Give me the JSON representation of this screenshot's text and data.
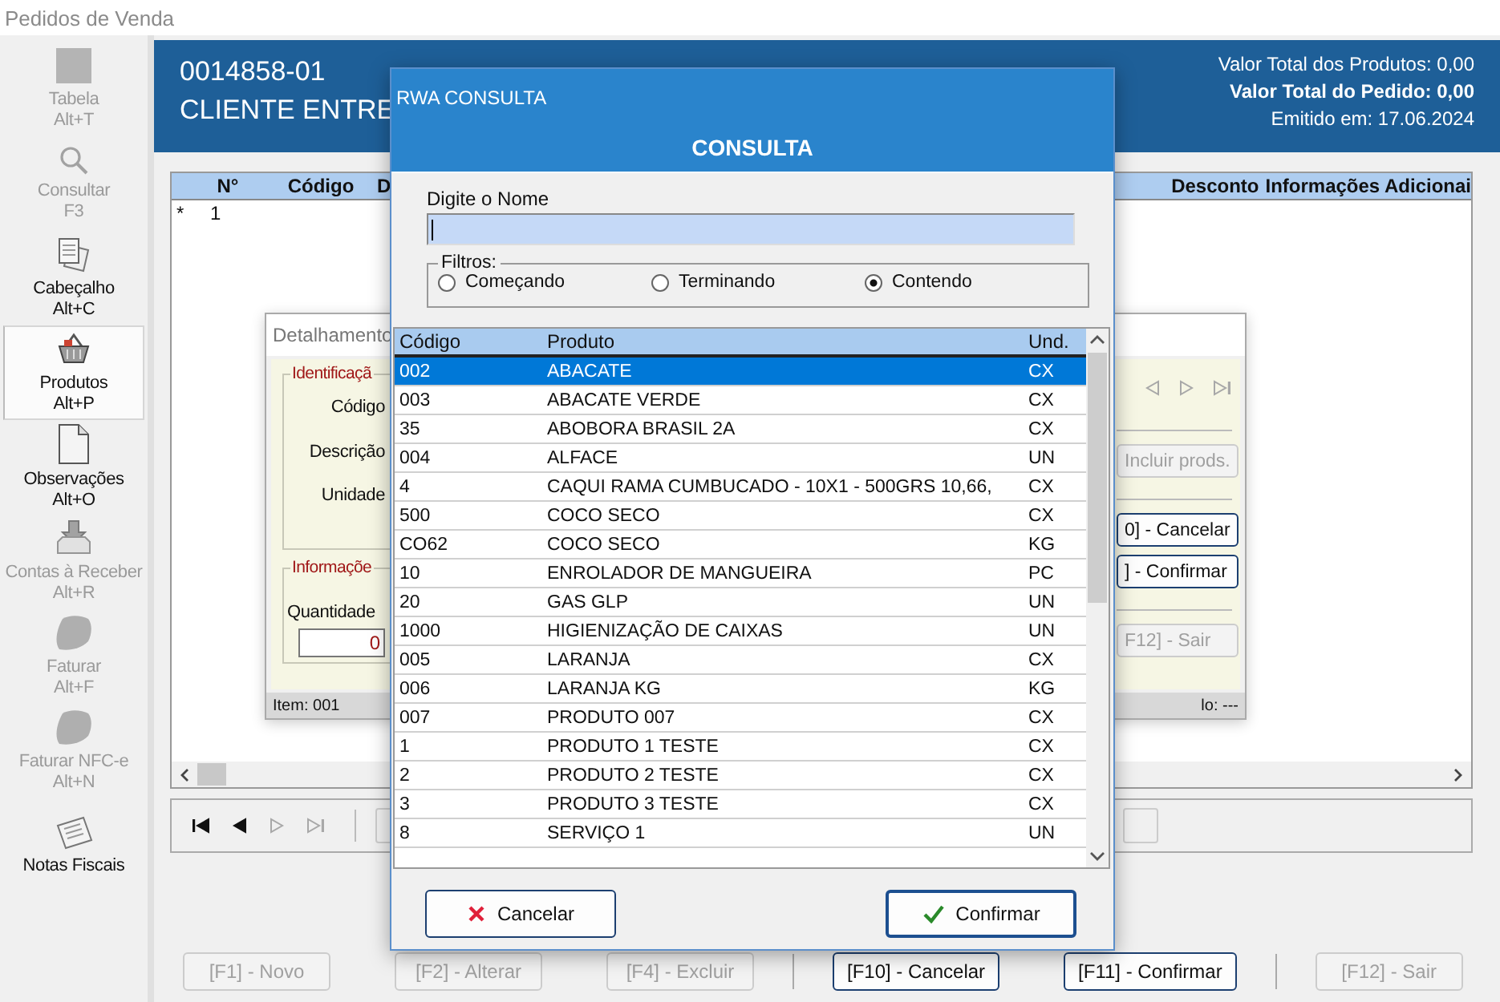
{
  "window": {
    "title": "Pedidos de Venda"
  },
  "sidebar": {
    "items": [
      {
        "label": "Tabela",
        "shortcut": "Alt+T",
        "disabled": true,
        "selected": false
      },
      {
        "label": "Consultar",
        "shortcut": "F3",
        "disabled": true,
        "selected": false
      },
      {
        "label": "Cabeçalho",
        "shortcut": "Alt+C",
        "disabled": false,
        "selected": false
      },
      {
        "label": "Produtos",
        "shortcut": "Alt+P",
        "disabled": false,
        "selected": true
      },
      {
        "label": "Observações",
        "shortcut": "Alt+O",
        "disabled": false,
        "selected": false
      },
      {
        "label": "Contas à Receber",
        "shortcut": "Alt+R",
        "disabled": true,
        "selected": false
      },
      {
        "label": "Faturar",
        "shortcut": "Alt+F",
        "disabled": true,
        "selected": false
      },
      {
        "label": "Faturar NFC-e",
        "shortcut": "Alt+N",
        "disabled": true,
        "selected": false
      },
      {
        "label": "Notas Fiscais",
        "disabled": false,
        "selected": false
      }
    ]
  },
  "order": {
    "number": "0014858-01",
    "client": "CLIENTE ENTRE",
    "summary": [
      {
        "text": "Valor Total dos Produtos: 0,00",
        "emphasis": false
      },
      {
        "text": "Valor Total do Pedido: 0,00",
        "emphasis": true
      },
      {
        "text": "Emitido em: 17.06.2024",
        "emphasis": false
      }
    ]
  },
  "items_table": {
    "columns": [
      "N°",
      "Código",
      "D",
      "Desconto",
      "Informações Adicionai"
    ],
    "rows": [
      {
        "marker": "*",
        "number": "1"
      }
    ]
  },
  "record_nav": [
    {
      "kind": "first",
      "disabled": false
    },
    {
      "kind": "prev",
      "disabled": false
    },
    {
      "kind": "next",
      "disabled": true
    },
    {
      "kind": "last",
      "disabled": true
    }
  ],
  "bottom_buttons": [
    {
      "label": "[F1] - Novo",
      "disabled": true
    },
    {
      "label": "[F2] - Alterar",
      "disabled": true
    },
    {
      "label": "[F4] - Excluir",
      "disabled": true
    },
    {
      "label": "[F10] - Cancelar",
      "disabled": false
    },
    {
      "label": "[F11] - Confirmar",
      "disabled": false
    },
    {
      "label": "[F12] - Sair",
      "disabled": true
    }
  ],
  "detail_dialog": {
    "title": "Detalhamento",
    "identification_group": "Identificaçã",
    "labels": [
      "Código",
      "Descrição",
      "Unidade"
    ],
    "info_group": "Informaçõe",
    "quantity_label": "Quantidade",
    "quantity_value": "0",
    "nav": [
      {
        "kind": "prev",
        "disabled": true
      },
      {
        "kind": "next",
        "disabled": true
      },
      {
        "kind": "last",
        "disabled": true
      }
    ],
    "buttons": [
      {
        "label": "Incluir prods.",
        "disabled": true
      },
      {
        "label": "0] - Cancelar",
        "disabled": false
      },
      {
        "label": "] - Confirmar",
        "disabled": false
      },
      {
        "label": "F12] - Sair",
        "disabled": true
      }
    ],
    "status_left": "Item: 001",
    "status_right": "lo: ---"
  },
  "consulta": {
    "window_title": "RWA CONSULTA",
    "heading": "CONSULTA",
    "search_label": "Digite o Nome",
    "filters": {
      "label": "Filtros:",
      "options": [
        {
          "label": "Começando",
          "selected": false
        },
        {
          "label": "Terminando",
          "selected": false
        },
        {
          "label": "Contendo",
          "selected": true
        }
      ]
    },
    "table": {
      "columns": [
        "Código",
        "Produto",
        "Und."
      ],
      "rows": [
        {
          "cells": [
            "002",
            "ABACATE",
            "CX"
          ],
          "selected": true
        },
        {
          "cells": [
            "003",
            "ABACATE VERDE",
            "CX"
          ],
          "selected": false
        },
        {
          "cells": [
            "35",
            "ABOBORA BRASIL 2A",
            "CX"
          ],
          "selected": false
        },
        {
          "cells": [
            "004",
            "ALFACE",
            "UN"
          ],
          "selected": false
        },
        {
          "cells": [
            "4",
            "CAQUI RAMA CUMBUCADO - 10X1 - 500GRS 10,66,",
            "CX"
          ],
          "selected": false
        },
        {
          "cells": [
            "500",
            "COCO SECO",
            "CX"
          ],
          "selected": false
        },
        {
          "cells": [
            "CO62",
            "COCO SECO",
            "KG"
          ],
          "selected": false
        },
        {
          "cells": [
            "10",
            "ENROLADOR DE MANGUEIRA",
            "PC"
          ],
          "selected": false
        },
        {
          "cells": [
            "20",
            "GAS GLP",
            "UN"
          ],
          "selected": false
        },
        {
          "cells": [
            "1000",
            "HIGIENIZAÇÃO DE CAIXAS",
            "UN"
          ],
          "selected": false
        },
        {
          "cells": [
            "005",
            "LARANJA",
            "CX"
          ],
          "selected": false
        },
        {
          "cells": [
            "006",
            "LARANJA KG",
            "KG"
          ],
          "selected": false
        },
        {
          "cells": [
            "007",
            "PRODUTO 007",
            "CX"
          ],
          "selected": false
        },
        {
          "cells": [
            "1",
            "PRODUTO 1 TESTE",
            "CX"
          ],
          "selected": false
        },
        {
          "cells": [
            "2",
            "PRODUTO 2 TESTE",
            "CX"
          ],
          "selected": false
        },
        {
          "cells": [
            "3",
            "PRODUTO 3 TESTE",
            "CX"
          ],
          "selected": false
        },
        {
          "cells": [
            "8",
            "SERVIÇO 1",
            "UN"
          ],
          "selected": false
        }
      ]
    },
    "buttons": [
      {
        "label": "Cancelar",
        "kind": "cancel"
      },
      {
        "label": "Confirmar",
        "kind": "confirm"
      }
    ]
  }
}
